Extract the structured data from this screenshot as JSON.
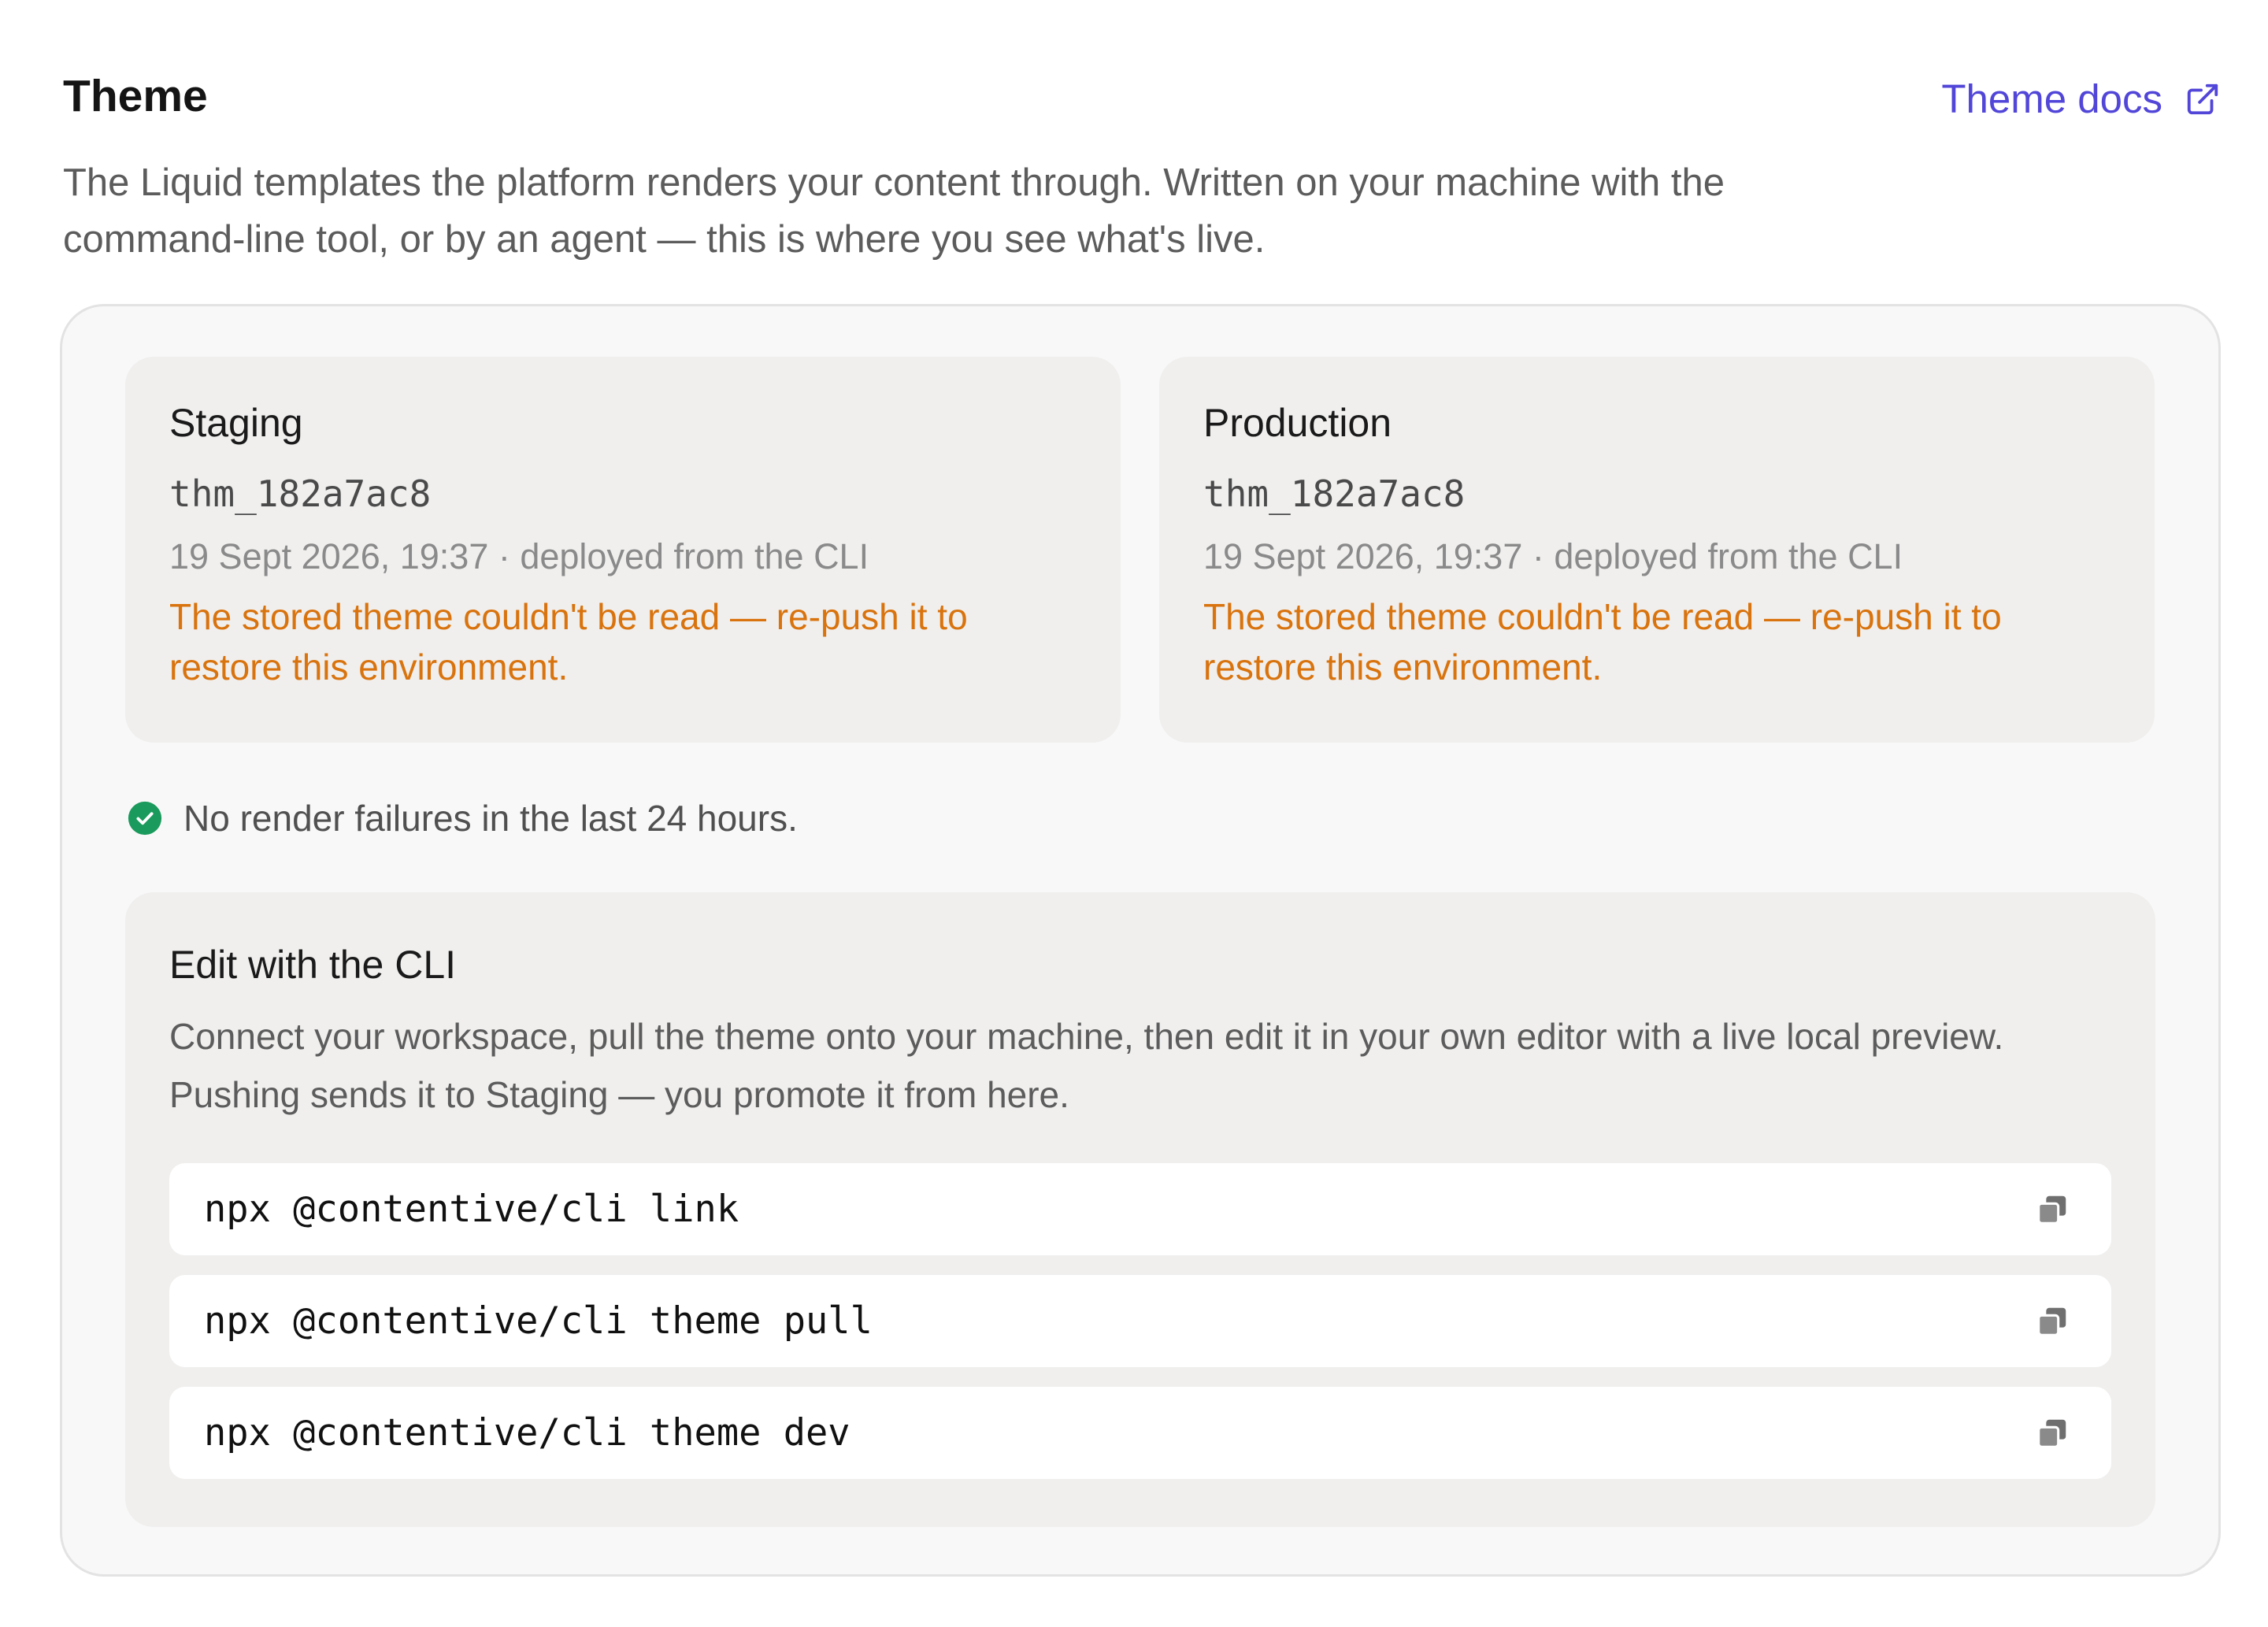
{
  "header": {
    "title": "Theme",
    "docs_link_label": "Theme docs",
    "intro": "The Liquid templates the platform renders your content through. Written on your machine with the command-line tool, or by an agent — this is where you see what's live."
  },
  "environments": [
    {
      "name": "Staging",
      "theme_id": "thm_182a7ac8",
      "meta": "19 Sept 2026, 19:37 · deployed from the CLI",
      "error": "The stored theme couldn't be read — re-push it to restore this environment."
    },
    {
      "name": "Production",
      "theme_id": "thm_182a7ac8",
      "meta": "19 Sept 2026, 19:37 · deployed from the CLI",
      "error": "The stored theme couldn't be read — re-push it to restore this environment."
    }
  ],
  "status": {
    "text": "No render failures in the last 24 hours.",
    "icon": "check-circle-icon",
    "color": "#1a9a5c"
  },
  "cli": {
    "title": "Edit with the CLI",
    "description": "Connect your workspace, pull the theme onto your machine, then edit it in your own editor with a live local preview. Pushing sends it to Staging — you promote it from here.",
    "commands": [
      "npx @contentive/cli link",
      "npx @contentive/cli theme pull",
      "npx @contentive/cli theme dev"
    ]
  },
  "colors": {
    "accent": "#5146d8",
    "warning": "#d9730d",
    "success": "#1a9a5c"
  }
}
